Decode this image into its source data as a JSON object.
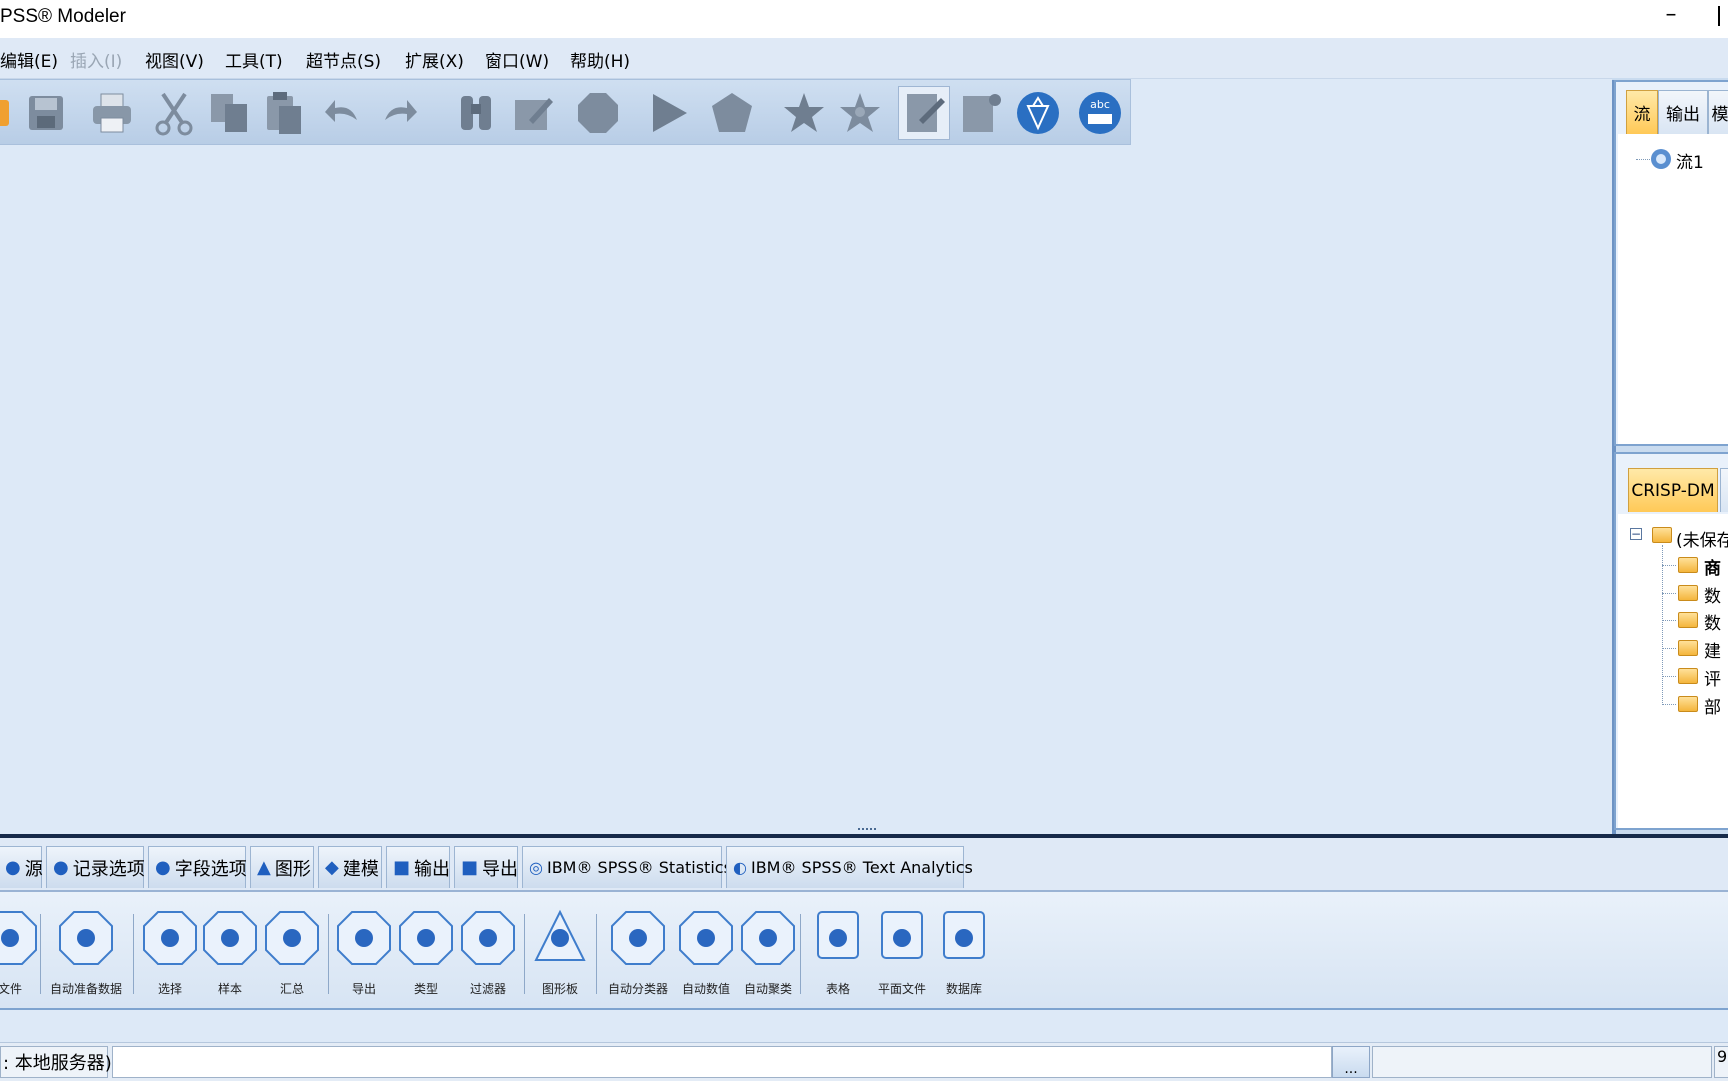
{
  "window": {
    "title": "PSS® Modeler"
  },
  "menu": [
    "编辑(E)",
    "插入(I)",
    "视图(V)",
    "工具(T)",
    "超节点(S)",
    "扩展(X)",
    "窗口(W)",
    "帮助(H)"
  ],
  "menu_disabled": [
    false,
    true,
    false,
    false,
    false,
    false,
    false,
    false
  ],
  "toolbar": [
    "open-icon",
    "save-icon",
    "print-icon",
    "cut-icon",
    "copy-icon",
    "paste-icon",
    "undo-icon",
    "redo-icon",
    "find-icon",
    "edit-icon",
    "stop-icon",
    "run-icon",
    "supernode-icon",
    "favorite-icon",
    "favorite-add-icon",
    "annotation-icon",
    "new-comment-icon",
    "model-icon",
    "spellcheck-icon"
  ],
  "managers": {
    "tabs": [
      "流",
      "输出",
      "模"
    ],
    "stream_item": "流1"
  },
  "project": {
    "tab": "CRISP-DM",
    "root": "(未保存",
    "folders": [
      "商",
      "数",
      "数",
      "建",
      "评",
      "部"
    ]
  },
  "palette": {
    "tabs": [
      "源",
      "记录选项",
      "字段选项",
      "图形",
      "建模",
      "输出",
      "导出",
      "IBM® SPSS® Statistics",
      "IBM® SPSS® Text Analytics"
    ],
    "nodes": [
      {
        "label": "文件",
        "icon": "var-file-icon"
      },
      {
        "label": "自动准备数据",
        "icon": "auto-data-prep-icon"
      },
      {
        "label": "选择",
        "icon": "select-icon"
      },
      {
        "label": "样本",
        "icon": "sample-icon"
      },
      {
        "label": "汇总",
        "icon": "aggregate-icon"
      },
      {
        "label": "导出",
        "icon": "derive-icon"
      },
      {
        "label": "类型",
        "icon": "type-icon"
      },
      {
        "label": "过滤器",
        "icon": "filter-icon"
      },
      {
        "label": "图形板",
        "icon": "graphboard-icon"
      },
      {
        "label": "自动分类器",
        "icon": "auto-classifier-icon"
      },
      {
        "label": "自动数值",
        "icon": "auto-numeric-icon"
      },
      {
        "label": "自动聚类",
        "icon": "auto-cluster-icon"
      },
      {
        "label": "表格",
        "icon": "table-icon"
      },
      {
        "label": "平面文件",
        "icon": "flat-file-icon"
      },
      {
        "label": "数据库",
        "icon": "database-icon"
      }
    ]
  },
  "status": {
    "server": ": 本地服务器)",
    "button": "...",
    "memory": "9"
  },
  "colors": {
    "canvas": "#dde9f7",
    "active_tab": "#ffc957",
    "node_blue": "#2a67c0"
  }
}
